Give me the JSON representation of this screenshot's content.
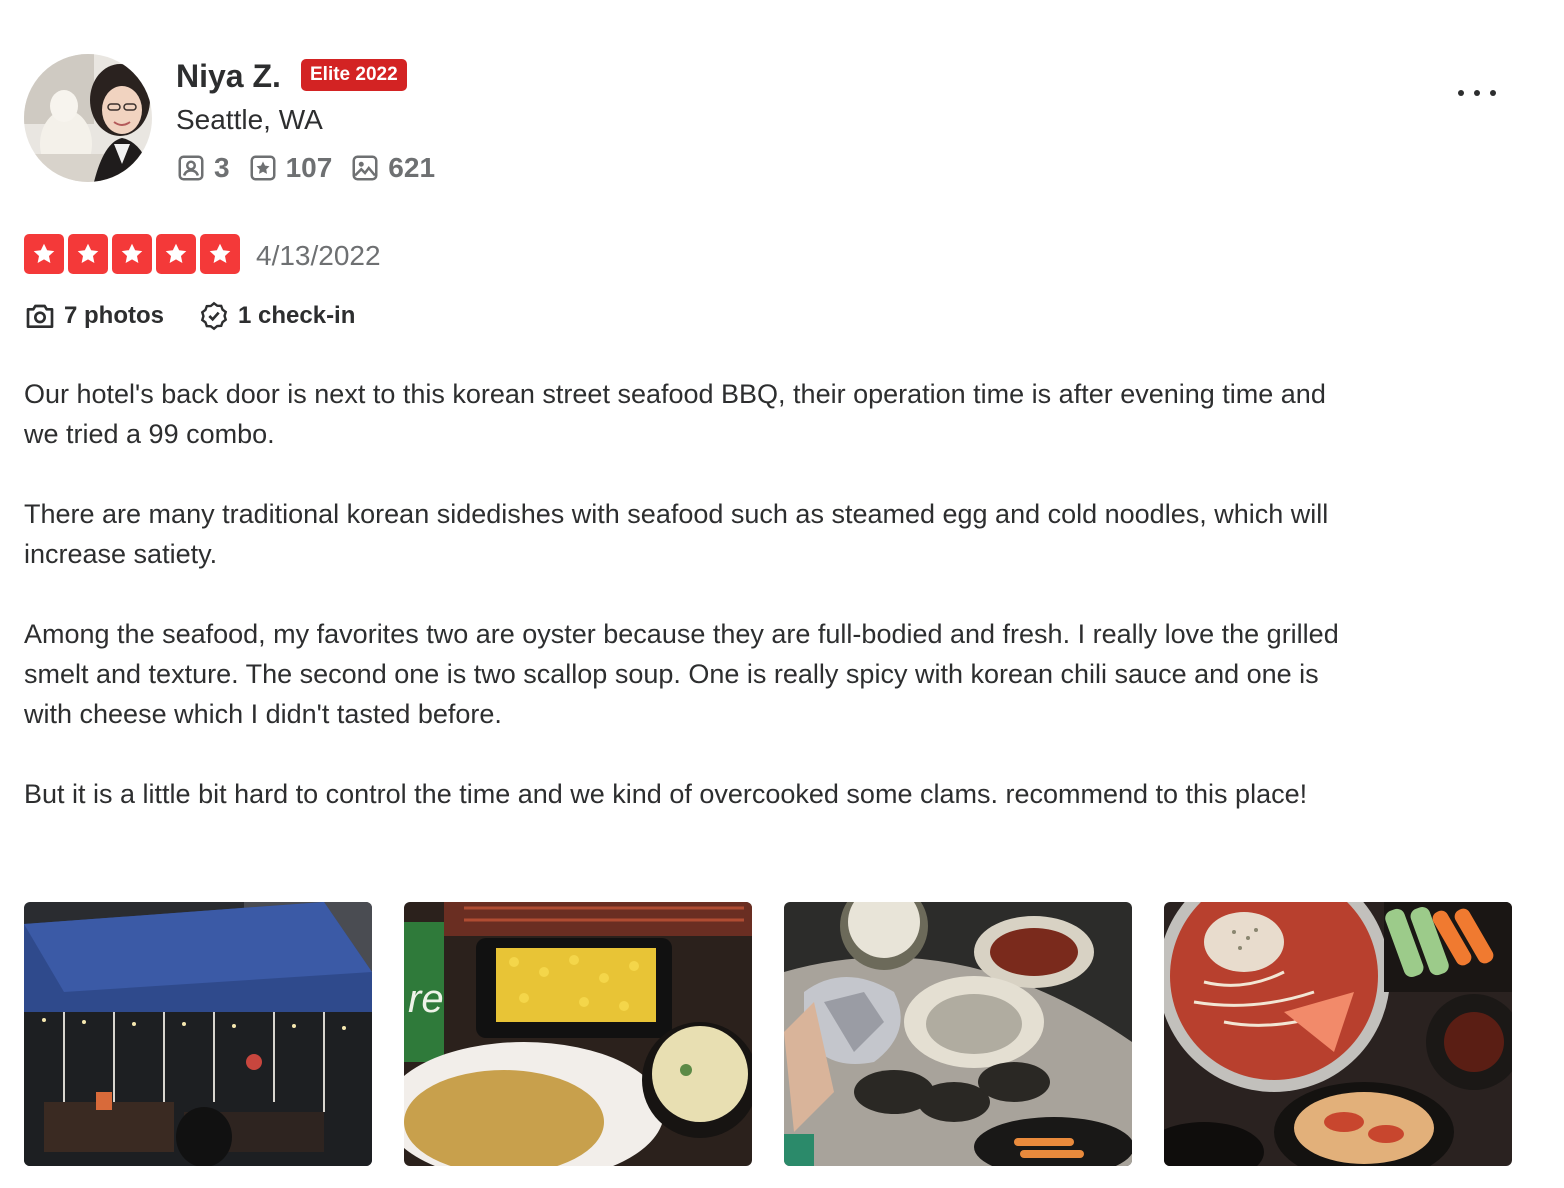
{
  "user": {
    "name": "Niya Z.",
    "badge": "Elite 2022",
    "location": "Seattle, WA",
    "stats": {
      "friends": "3",
      "reviews": "107",
      "photos": "621"
    }
  },
  "review": {
    "rating": 5,
    "date": "4/13/2022",
    "photos_label": "7 photos",
    "checkin_label": "1 check-in",
    "paragraphs": [
      "Our hotel's back door is next to this korean street seafood BBQ, their operation time is after evening time and we tried a 99 combo.",
      "There are many traditional korean sidedishes with seafood such as steamed egg and cold noodles, which will increase satiety.",
      "Among the seafood, my favorites two are oyster because they are full-bodied and fresh. I really love the grilled smelt and texture. The second one is two scallop soup. One is really spicy with korean chili sauce and one is with cheese which I didn't tasted before.",
      "But it is a little bit hard to control the time and we kind of overcooked some clams. recommend to this place!"
    ]
  },
  "colors": {
    "star": "#f43939",
    "elite": "#d32323",
    "text": "#2d2e2f",
    "muted": "#6e7072"
  },
  "icons": [
    "friends-icon",
    "reviews-star-icon",
    "photos-icon",
    "camera-icon",
    "checkin-icon",
    "more-options-icon"
  ]
}
